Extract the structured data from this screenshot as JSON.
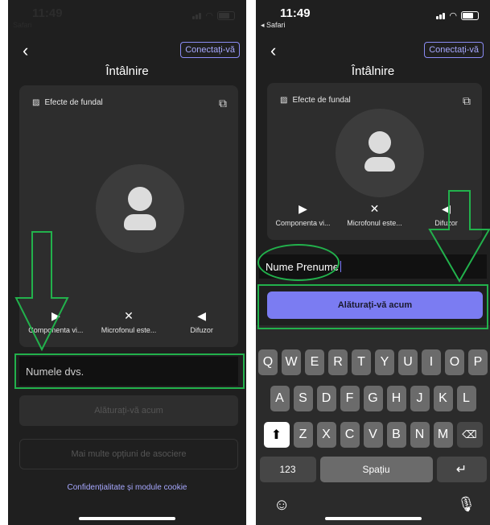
{
  "left_screen": {
    "status_time": "11:49",
    "back_label": "Safari",
    "connect_label": "Conectați-vă",
    "title": "Întâlnire",
    "bg_effects_label": "Efecte de fundal",
    "controls": [
      {
        "icon": "camera-off-icon",
        "label": "Componenta vi..."
      },
      {
        "icon": "mic-off-icon",
        "label": "Microfonul este..."
      },
      {
        "icon": "speaker-icon",
        "label": "Difuzor"
      }
    ],
    "name_placeholder": "Numele dvs.",
    "join_label": "Alăturați-vă acum",
    "more_options_label": "Mai multe opțiuni de asociere",
    "privacy_label": "Confidențialitate și module cookie"
  },
  "right_screen": {
    "status_time": "11:49",
    "back_label": "◂ Safari",
    "connect_label": "Conectați-vă",
    "title": "Întâlnire",
    "bg_effects_label": "Efecte de fundal",
    "controls": [
      {
        "icon": "camera-off-icon",
        "label": "Componenta vi..."
      },
      {
        "icon": "mic-off-icon",
        "label": "Microfonul este..."
      },
      {
        "icon": "speaker-icon",
        "label": "Difuzor"
      }
    ],
    "name_value": "Nume Prenume",
    "join_label": "Alăturați-vă acum",
    "keyboard": {
      "row1": [
        "Q",
        "W",
        "E",
        "R",
        "T",
        "Y",
        "U",
        "I",
        "O",
        "P"
      ],
      "row2": [
        "A",
        "S",
        "D",
        "F",
        "G",
        "H",
        "J",
        "K",
        "L"
      ],
      "row3": [
        "Z",
        "X",
        "C",
        "V",
        "B",
        "N",
        "M"
      ],
      "numbers_key": "123",
      "space_key": "Spațiu"
    }
  },
  "colors": {
    "accent": "#7b7cf2",
    "annotation": "#22b14c",
    "background": "#1f1f1f"
  }
}
